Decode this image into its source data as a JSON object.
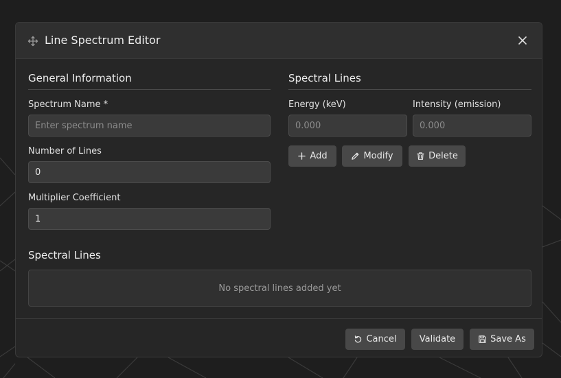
{
  "dialog": {
    "title": "Line Spectrum Editor",
    "move_icon": "move-icon",
    "close_icon": "close-icon"
  },
  "general": {
    "heading": "General Information",
    "spectrum_name_label": "Spectrum Name *",
    "spectrum_name_placeholder": "Enter spectrum name",
    "spectrum_name_value": "",
    "num_lines_label": "Number of Lines",
    "num_lines_value": "0",
    "multiplier_label": "Multiplier Coefficient",
    "multiplier_value": "1"
  },
  "spectral_editor": {
    "heading": "Spectral Lines",
    "energy_label": "Energy (keV)",
    "energy_placeholder": "0.000",
    "intensity_label": "Intensity (emission)",
    "intensity_placeholder": "0.000",
    "add_label": "Add",
    "modify_label": "Modify",
    "delete_label": "Delete"
  },
  "spectral_list": {
    "heading": "Spectral Lines",
    "empty_text": "No spectral lines added yet"
  },
  "footer": {
    "cancel_label": "Cancel",
    "validate_label": "Validate",
    "save_as_label": "Save As"
  },
  "colors": {
    "background": "#1e1e1e",
    "dialog": "#262626",
    "header": "#2f2f2f",
    "input": "#3a3a3a",
    "button": "#484848"
  }
}
